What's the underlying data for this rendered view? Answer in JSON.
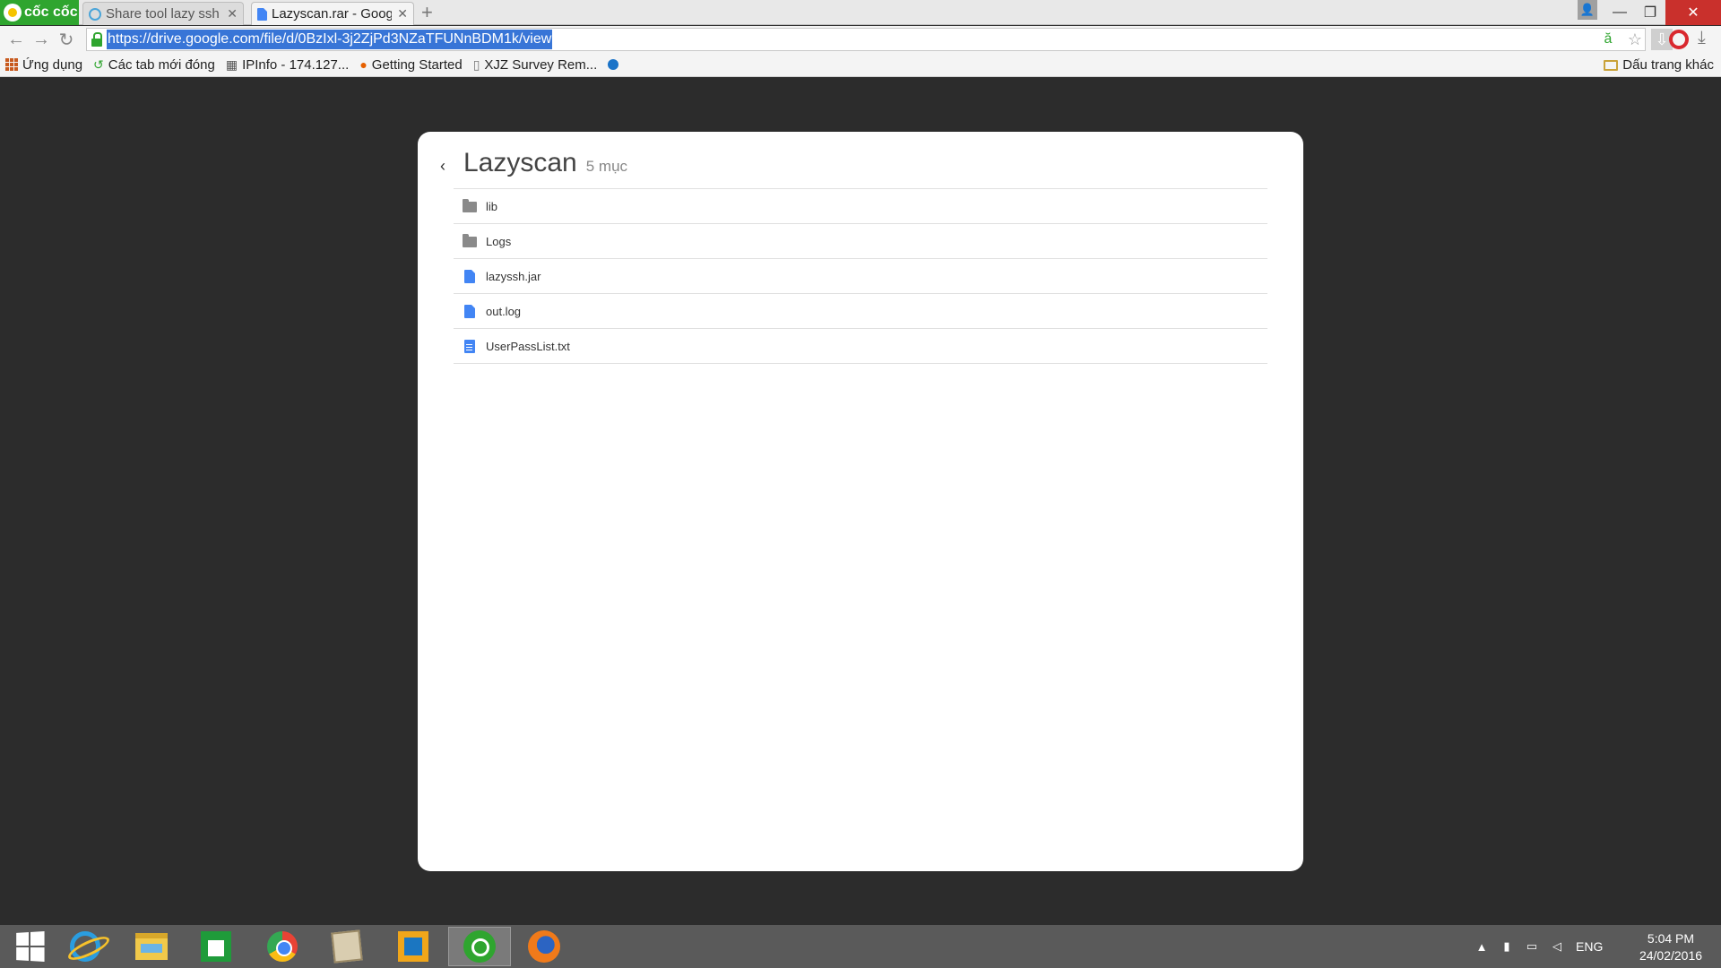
{
  "browser": {
    "brand": "cốc cốc",
    "tabs": [
      {
        "title": "Share tool lazy ssh kh",
        "active": false
      },
      {
        "title": "Lazyscan.rar - Google",
        "active": true
      }
    ],
    "url": "https://drive.google.com/file/d/0BzIxl-3j2ZjPd3NZaTFUNnBDM1k/view",
    "bookmarks": [
      {
        "label": "Ứng dụng",
        "icon": "apps-grid-icon"
      },
      {
        "label": "Các tab mới đóng",
        "icon": "history-icon"
      },
      {
        "label": "IPInfo - 174.127...",
        "icon": "ipinfo-icon"
      },
      {
        "label": "Getting Started",
        "icon": "firefox-icon"
      },
      {
        "label": "XJZ Survey Rem...",
        "icon": "page-icon"
      }
    ],
    "other_bookmarks": "Dấu trang khác"
  },
  "viewer": {
    "title": "Lazyscan",
    "count": "5 mục",
    "items": [
      {
        "name": "lib",
        "type": "folder"
      },
      {
        "name": "Logs",
        "type": "folder"
      },
      {
        "name": "lazyssh.jar",
        "type": "file"
      },
      {
        "name": "out.log",
        "type": "file"
      },
      {
        "name": "UserPassList.txt",
        "type": "text"
      }
    ]
  },
  "taskbar": {
    "language": "ENG",
    "time": "5:04 PM",
    "date": "24/02/2016"
  },
  "colors": {
    "brand_green": "#2fa52f",
    "url_highlight": "#3875d7",
    "page_background": "#2c2c2c",
    "file_blue": "#4285f4"
  }
}
